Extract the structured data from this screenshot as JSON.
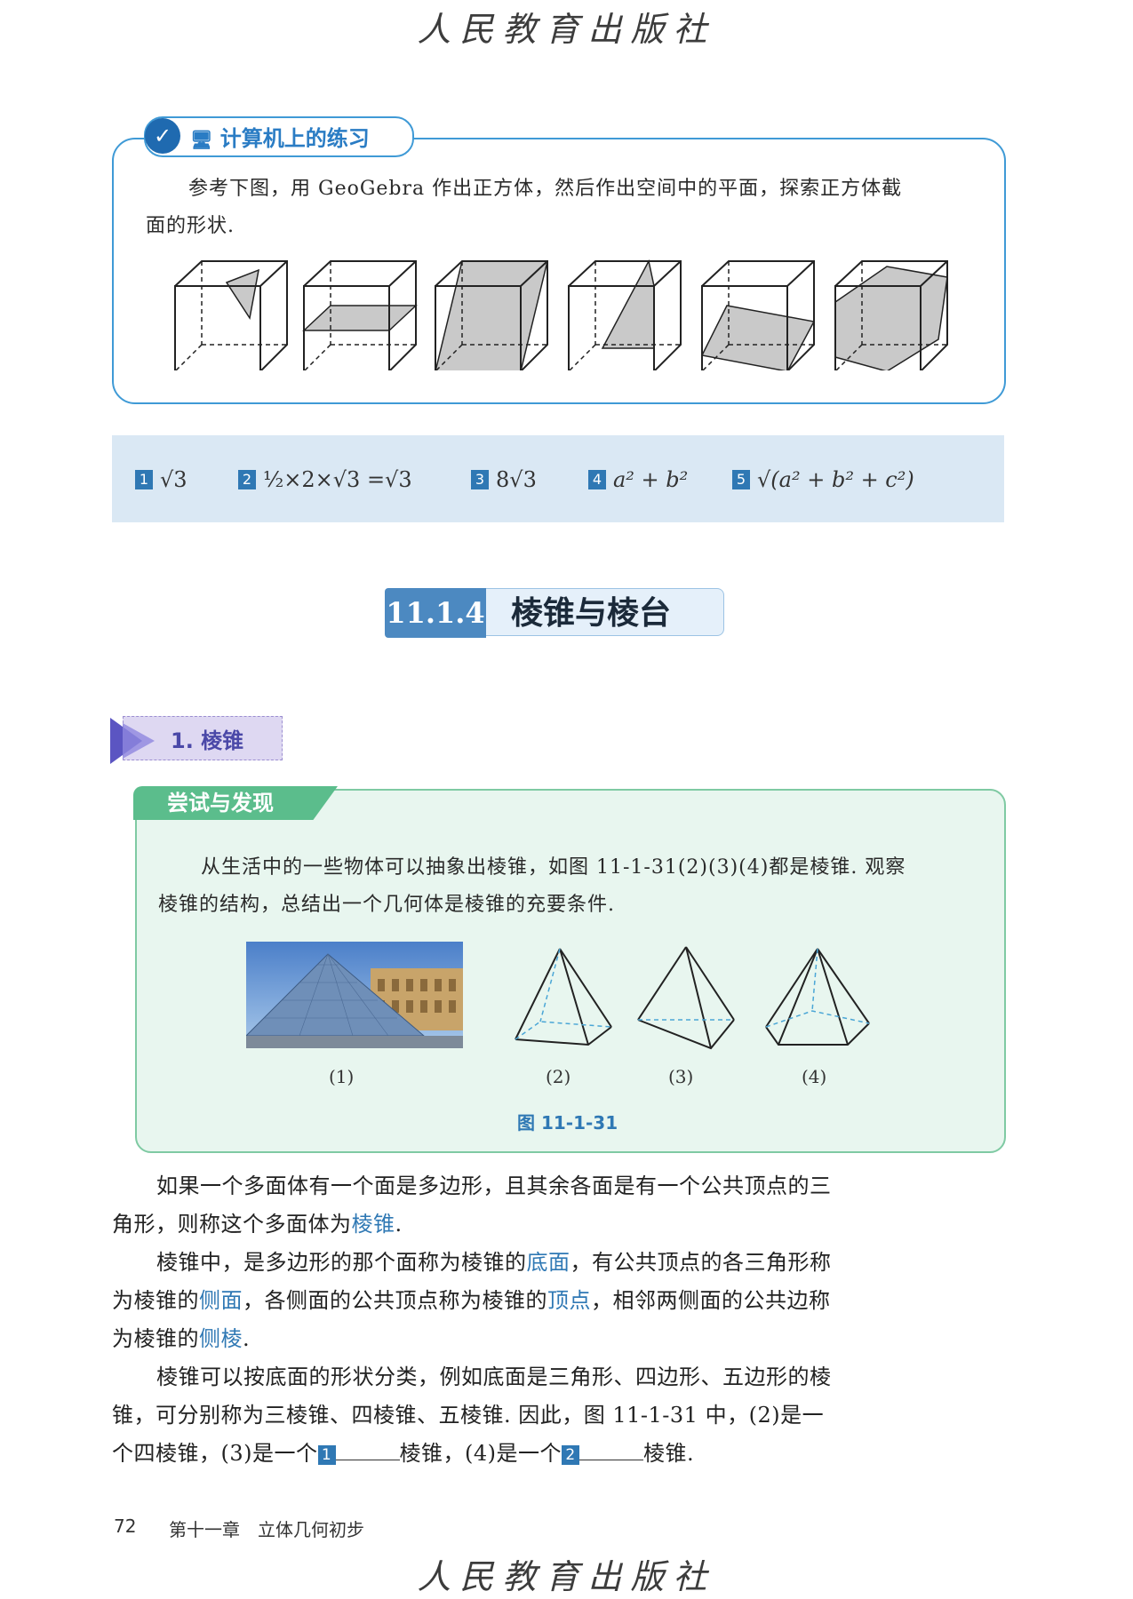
{
  "publisher": "人民教育出版社",
  "computer_practice": {
    "title": "计算机上的练习",
    "text_line1": "参考下图，用 GeoGebra 作出正方体，然后作出空间中的平面，探索正方体截",
    "text_line2": "面的形状."
  },
  "answers": [
    {
      "num": "1",
      "text": "√3"
    },
    {
      "num": "2",
      "text": "½×2×√3 =√3"
    },
    {
      "num": "3",
      "text": "8√3"
    },
    {
      "num": "4",
      "text": "a² + b²"
    },
    {
      "num": "5",
      "text": "√(a² + b² + c²)"
    }
  ],
  "section": {
    "number": "11.1.4",
    "title": "棱锥与棱台"
  },
  "subsection": {
    "title": "1. 棱锥"
  },
  "try_discover": {
    "title": "尝试与发现",
    "text_line1": "从生活中的一些物体可以抽象出棱锥，如图 11-1-31(2)(3)(4)都是棱锥. 观察",
    "text_line2": "棱锥的结构，总结出一个几何体是棱锥的充要条件.",
    "captions": [
      "(1)",
      "(2)",
      "(3)",
      "(4)"
    ],
    "figure_caption": "图 11-1-31"
  },
  "body": {
    "p1_a": "如果一个多面体有一个面是多边形，且其余各面是有一个公共顶点的三",
    "p1_b": "角形，则称这个多面体为",
    "p1_term": "棱锥",
    "p1_end": ".",
    "p2_a": "棱锥中，是多边形的那个面称为棱锥的",
    "p2_term1": "底面",
    "p2_b": "，有公共顶点的各三角形称",
    "p2_c": "为棱锥的",
    "p2_term2": "侧面",
    "p2_d": "，各侧面的公共顶点称为棱锥的",
    "p2_term3": "顶点",
    "p2_e": "，相邻两侧面的公共边称",
    "p2_f": "为棱锥的",
    "p2_term4": "侧棱",
    "p2_g": ".",
    "p3_a": "棱锥可以按底面的形状分类，例如底面是三角形、四边形、五边形的棱",
    "p3_b": "锥，可分别称为三棱锥、四棱锥、五棱锥. 因此，图 11-1-31 中，(2)是一",
    "p3_c1": "个四棱锥，(3)是一个",
    "p3_blank1": "1",
    "p3_c2": "棱锥，(4)是一个",
    "p3_blank2": "2",
    "p3_c3": "棱锥."
  },
  "footer": {
    "page": "72",
    "chapter": "第十一章　立体几何初步"
  },
  "colors": {
    "blue": "#2f78b4",
    "green": "#5bbd8c",
    "purple": "#4a48a8"
  }
}
